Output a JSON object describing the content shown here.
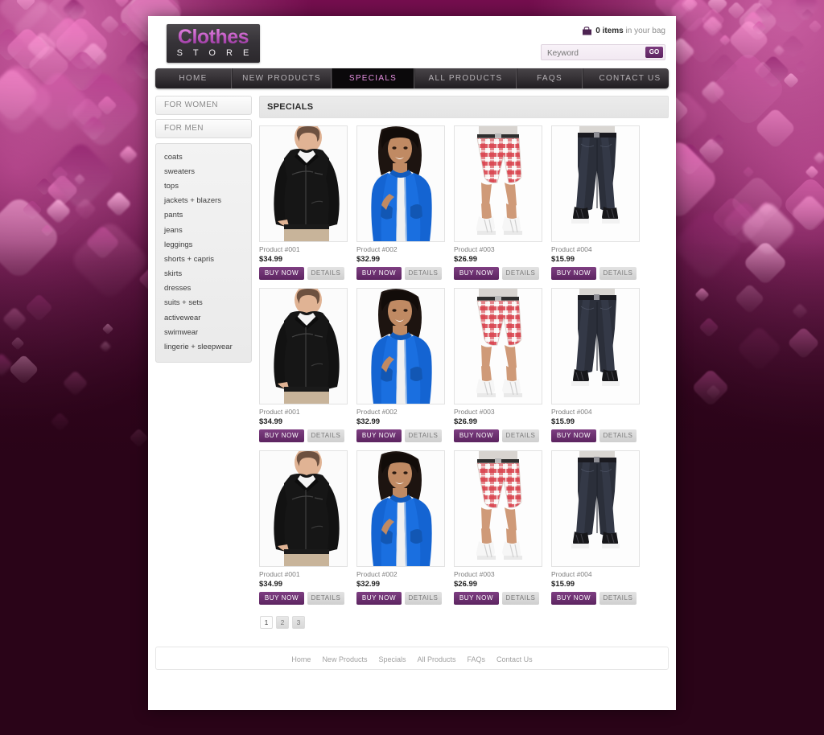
{
  "background": {
    "base_color": "#2a0418",
    "accent_color": "#e85ab4",
    "highlight_color": "#ff96d7"
  },
  "header": {
    "logo_line1": "Clothes",
    "logo_line2": "S T O R E",
    "cart_icon": "shopping-bag-icon",
    "cart_count": "0 items",
    "cart_suffix": "in your bag",
    "search_placeholder": "Keyword",
    "search_value": "",
    "search_button": "GO",
    "accent_color": "#5c2460"
  },
  "nav": {
    "items": [
      {
        "label": "HOME",
        "active": false,
        "width": 94
      },
      {
        "label": "NEW PRODUCTS",
        "active": false,
        "width": 122
      },
      {
        "label": "SPECIALS",
        "active": true,
        "width": 101
      },
      {
        "label": "ALL PRODUCTS",
        "active": false,
        "width": 125
      },
      {
        "label": "FAQS",
        "active": false,
        "width": 80
      },
      {
        "label": "CONTACT US",
        "active": false,
        "width": 116
      }
    ]
  },
  "sidebar": {
    "buttons": [
      {
        "label": "FOR WOMEN"
      },
      {
        "label": "FOR MEN"
      }
    ],
    "categories": [
      "coats",
      "sweaters",
      "tops",
      "jackets + blazers",
      "pants",
      "jeans",
      "leggings",
      "shorts + capris",
      "skirts",
      "dresses",
      "suits + sets",
      "activewear",
      "swimwear",
      "lingerie + sleepwear"
    ]
  },
  "main": {
    "page_title": "SPECIALS",
    "buy_label": "BUY NOW",
    "details_label": "DETAILS",
    "products": [
      {
        "name": "Product #001",
        "price": "$34.99",
        "image": "black-softshell-jacket-man"
      },
      {
        "name": "Product #002",
        "price": "$32.99",
        "image": "blue-zip-hoodie-woman"
      },
      {
        "name": "Product #003",
        "price": "$26.99",
        "image": "red-plaid-shorts-man"
      },
      {
        "name": "Product #004",
        "price": "$15.99",
        "image": "dark-slim-jeans"
      },
      {
        "name": "Product #001",
        "price": "$34.99",
        "image": "black-softshell-jacket-man"
      },
      {
        "name": "Product #002",
        "price": "$32.99",
        "image": "blue-zip-hoodie-woman"
      },
      {
        "name": "Product #003",
        "price": "$26.99",
        "image": "red-plaid-shorts-man"
      },
      {
        "name": "Product #004",
        "price": "$15.99",
        "image": "dark-slim-jeans"
      },
      {
        "name": "Product #001",
        "price": "$34.99",
        "image": "black-softshell-jacket-man"
      },
      {
        "name": "Product #002",
        "price": "$32.99",
        "image": "blue-zip-hoodie-woman"
      },
      {
        "name": "Product #003",
        "price": "$26.99",
        "image": "red-plaid-shorts-man"
      },
      {
        "name": "Product #004",
        "price": "$15.99",
        "image": "dark-slim-jeans"
      }
    ],
    "pagination": [
      {
        "label": "1",
        "active": true
      },
      {
        "label": "2",
        "active": false
      },
      {
        "label": "3",
        "active": false
      }
    ]
  },
  "footer": {
    "links": [
      "Home",
      "New Products",
      "Specials",
      "All Products",
      "FAQs",
      "Contact Us"
    ]
  }
}
